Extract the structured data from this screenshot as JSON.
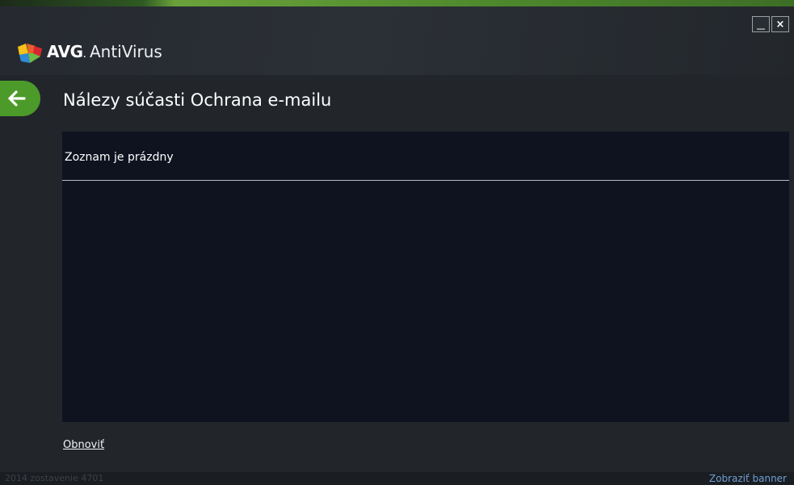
{
  "app": {
    "brand": "AVG",
    "brand_dot": ".",
    "product": "AntiVirus"
  },
  "window": {
    "minimize": "__",
    "close": "×"
  },
  "page": {
    "title": "Nálezy súčasti Ochrana e-mailu"
  },
  "list": {
    "empty_message": "Zoznam je prázdny"
  },
  "actions": {
    "refresh_label": "Obnoviť"
  },
  "footer": {
    "build": "2014  zostavenie 4701",
    "show_banner": "Zobraziť banner"
  },
  "icons": {
    "back": "arrow-left-icon",
    "logo": "avg-logo-icon"
  },
  "colors": {
    "accent_green": "#4c9a2a",
    "background": "#22262b",
    "panel": "#0f1320",
    "link_blue": "#6f9fd6"
  }
}
